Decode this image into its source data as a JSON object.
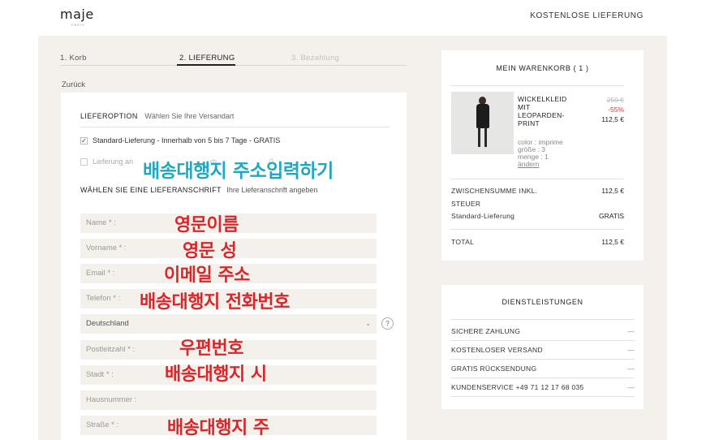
{
  "header": {
    "logo": "maje",
    "logo_sub": "PARIS",
    "free_delivery": "KOSTENLOSE LIEFERUNG"
  },
  "steps": [
    {
      "label": "1. Korb",
      "active": false
    },
    {
      "label": "2. LIEFERUNG",
      "active": true
    },
    {
      "label": "3. Bezahlung",
      "active": false
    }
  ],
  "back": "Zurück",
  "delivery": {
    "label": "LIEFEROPTION",
    "sub": "Wählen Sie Ihre Versandart",
    "options": [
      {
        "bold": "Standard-Lieferung",
        "text": " - Innerhalb von 5 bis 7 Tage - GRATIS",
        "checked": true
      },
      {
        "bold": "",
        "text": "Lieferung an",
        "checked": false
      }
    ],
    "partial_text": "rh",
    "partial_num": "0"
  },
  "address": {
    "label": "WÄHLEN SIE EINE LIEFERANSCHRIFT",
    "sub": "Ihre Lieferanschrift angeben"
  },
  "fields": {
    "name": "Name * :",
    "first": "Vorname * :",
    "email": "Email * :",
    "phone": "Telefon * :",
    "country": "Deutschland",
    "zip": "Postleitzahl * :",
    "city": "Stadt * :",
    "house": "Hausnummer :",
    "street": "Straße * :"
  },
  "help": "?",
  "annotations": {
    "title": "배송대행지 주소입력하기",
    "name": "영문이름",
    "first": "영문 성",
    "email": "이메일 주소",
    "phone": "배송대행지 전화번호",
    "zip": "우편번호",
    "city": "배송대행지 시",
    "street": "배송대행지 주"
  },
  "cart": {
    "title": "MEIN WARENKORB ( 1 )",
    "product": {
      "name": "WICKELKLEID MIT LEOPARDEN-PRINT",
      "old_price": "250 €",
      "discount": "-55%",
      "price": "112,5 €",
      "color": "color : imprime",
      "size": "größe : 3",
      "qty": "menge : 1",
      "edit": "ändern"
    },
    "subtotal_label_1": "ZWISCHENSUMME INKL.",
    "subtotal_label_2": "STEUER",
    "subtotal_value": "112,5 €",
    "shipping_label": "Standard-Lieferung",
    "shipping_value": "GRATIS",
    "total_label": "TOTAL",
    "total_value": "112,5 €"
  },
  "services": {
    "title": "DIENSTLEISTUNGEN",
    "items": [
      "SICHERE ZAHLUNG",
      "KOSTENLOSER VERSAND",
      "GRATIS RÜCKSENDUNG",
      "KUNDENSERVICE +49 71 12 17 68 035"
    ],
    "dash": "—"
  },
  "icons": {
    "checkmark": "✓",
    "chevron": "⌄"
  }
}
